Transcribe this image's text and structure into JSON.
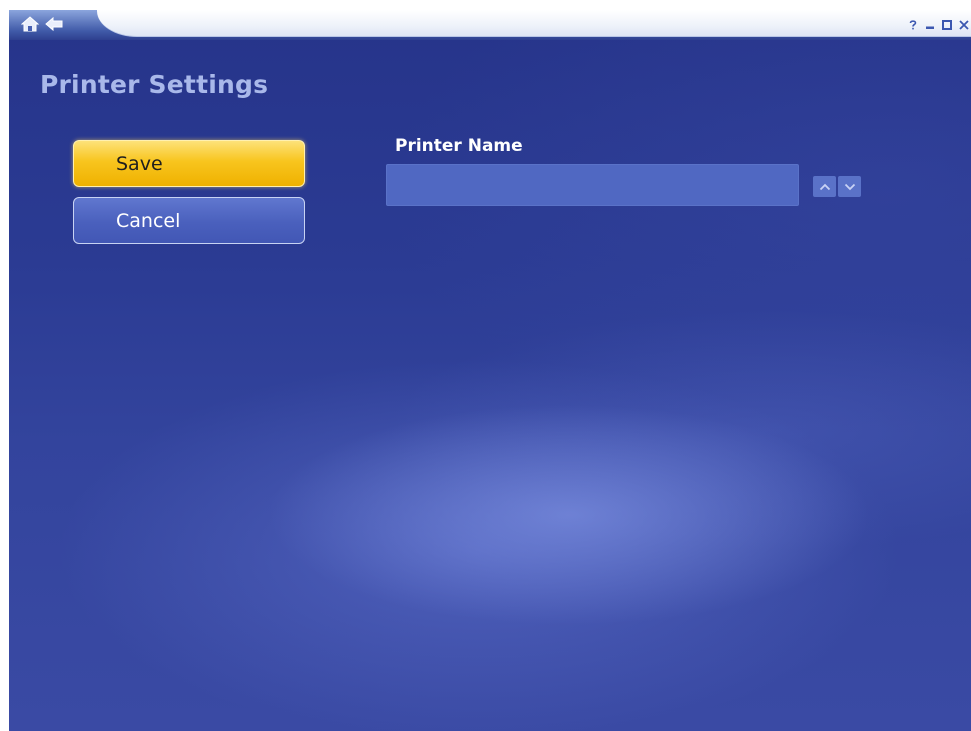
{
  "header": {
    "nav": {
      "home_icon": "home-icon",
      "back_icon": "back-arrow-icon"
    },
    "window_controls": [
      "help-icon",
      "minimize-icon",
      "maximize-icon",
      "close-icon"
    ]
  },
  "page": {
    "title": "Printer Settings"
  },
  "actions": {
    "save_label": "Save",
    "cancel_label": "Cancel"
  },
  "form": {
    "printer_name": {
      "label": "Printer Name",
      "value": "",
      "spinner_icons": [
        "chevron-up-icon",
        "chevron-down-icon"
      ]
    }
  },
  "colors": {
    "background": "#2b3b93",
    "focused_button": "#f8c51e",
    "button": "#4a60bd",
    "title_text": "#a9b8ea"
  }
}
